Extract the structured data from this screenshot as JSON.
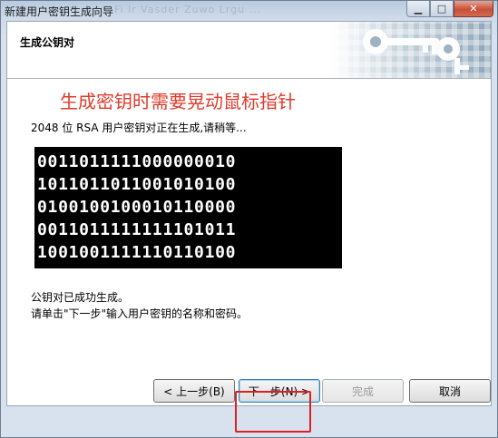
{
  "window": {
    "title": "新建用户密钥生成向导",
    "ghost_title": "Fi lr Vasder Zuwo Lrgu ..."
  },
  "header": {
    "title": "生成公钥对"
  },
  "annotation": "生成密钥时需要晃动鼠标指针",
  "status_line": "2048 位 RSA 用户密钥对正在生成,请稍等...",
  "binary_rows": [
    "0011011111000000010",
    "1011011011001010100",
    "0100100100010110000",
    "0011011111111101011",
    "1001001111110110100"
  ],
  "messages": {
    "done": "公钥对已成功生成。",
    "instruction": "请单击\"下一步\"输入用户密钥的名称和密码。"
  },
  "buttons": {
    "back": "< 上一步(B)",
    "next": "下一步(N) >",
    "finish": "完成",
    "cancel": "取消"
  },
  "colors": {
    "annotation": "#e03a2c",
    "highlight": "#e02020"
  }
}
